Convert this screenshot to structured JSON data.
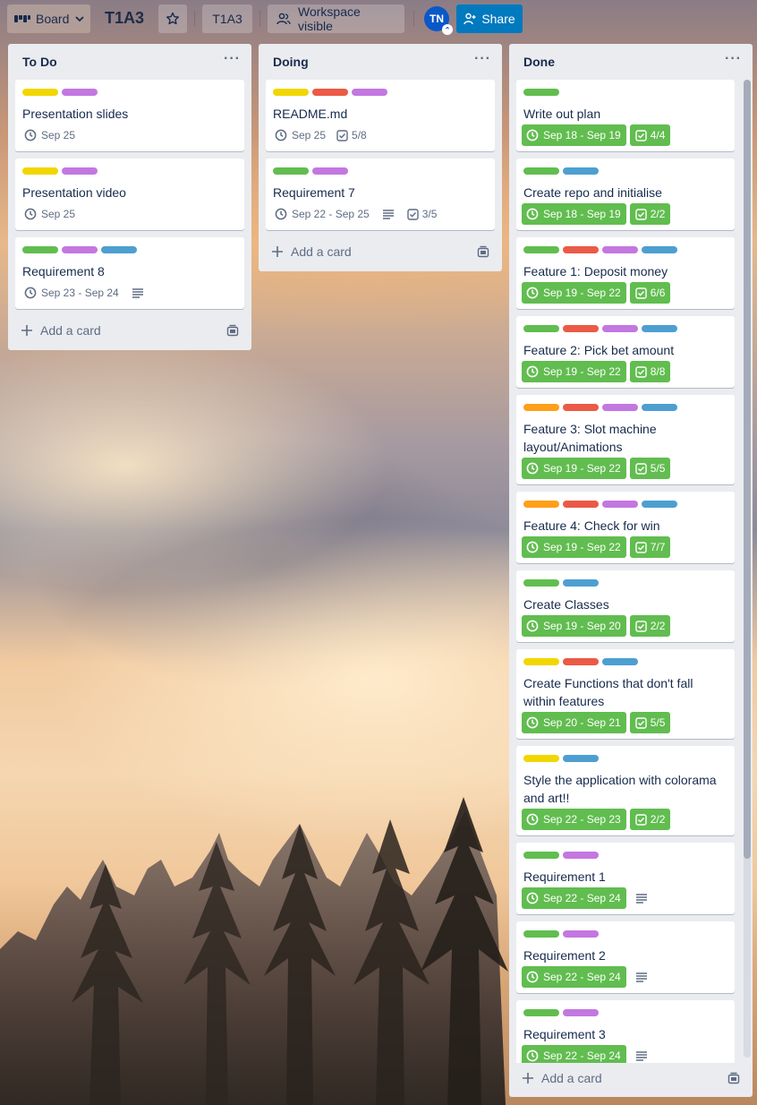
{
  "header": {
    "board_btn": "Board",
    "title": "T1A3",
    "workspace": "T1A3",
    "visibility": "Workspace visible",
    "avatar": "TN",
    "share": "Share"
  },
  "colors": {
    "green": "#61bd4f",
    "yellow": "#f2d600",
    "orange": "#ff9f1a",
    "red": "#eb5a46",
    "purple": "#c377e0",
    "blue": "#0079bf",
    "sky": "#4d9fd1"
  },
  "lists": {
    "todo": {
      "title": "To Do",
      "add_card": "Add a card",
      "cards": [
        {
          "title": "Presentation slides",
          "labels": [
            "yellow",
            "purple"
          ],
          "due": "Sep 25"
        },
        {
          "title": "Presentation video",
          "labels": [
            "yellow",
            "purple"
          ],
          "due": "Sep 25"
        },
        {
          "title": "Requirement 8",
          "labels": [
            "green",
            "purple",
            "sky"
          ],
          "due": "Sep 23 - Sep 24",
          "description": true
        }
      ]
    },
    "doing": {
      "title": "Doing",
      "add_card": "Add a card",
      "cards": [
        {
          "title": "README.md",
          "labels": [
            "yellow",
            "red",
            "purple"
          ],
          "due": "Sep 25",
          "checklist": "5/8"
        },
        {
          "title": "Requirement 7",
          "labels": [
            "green",
            "purple"
          ],
          "due": "Sep 22 - Sep 25",
          "description": true,
          "checklist": "3/5"
        }
      ]
    },
    "done": {
      "title": "Done",
      "add_card": "Add a card",
      "cards": [
        {
          "title": "Write out plan",
          "labels": [
            "green"
          ],
          "due": "Sep 18 - Sep 19",
          "checklist": "4/4"
        },
        {
          "title": "Create repo and initialise",
          "labels": [
            "green",
            "sky"
          ],
          "due": "Sep 18 - Sep 19",
          "checklist": "2/2"
        },
        {
          "title": "Feature 1: Deposit money",
          "labels": [
            "green",
            "red",
            "purple",
            "sky"
          ],
          "due": "Sep 19 - Sep 22",
          "checklist": "6/6"
        },
        {
          "title": "Feature 2: Pick bet amount",
          "labels": [
            "green",
            "red",
            "purple",
            "sky"
          ],
          "due": "Sep 19 - Sep 22",
          "checklist": "8/8"
        },
        {
          "title": "Feature 3: Slot machine layout/Animations",
          "labels": [
            "orange",
            "red",
            "purple",
            "sky"
          ],
          "due": "Sep 19 - Sep 22",
          "checklist": "5/5"
        },
        {
          "title": "Feature 4: Check for win",
          "labels": [
            "orange",
            "red",
            "purple",
            "sky"
          ],
          "due": "Sep 19 - Sep 22",
          "checklist": "7/7"
        },
        {
          "title": "Create Classes",
          "labels": [
            "green",
            "sky"
          ],
          "due": "Sep 19 - Sep 20",
          "checklist": "2/2"
        },
        {
          "title": "Create Functions that don't fall within features",
          "labels": [
            "yellow",
            "red",
            "sky"
          ],
          "due": "Sep 20 - Sep 21",
          "checklist": "5/5"
        },
        {
          "title": "Style the application with colorama and art!!",
          "labels": [
            "yellow",
            "sky"
          ],
          "due": "Sep 22 - Sep 23",
          "checklist": "2/2"
        },
        {
          "title": "Requirement 1",
          "labels": [
            "green",
            "purple"
          ],
          "due": "Sep 22 - Sep 24",
          "description": true
        },
        {
          "title": "Requirement 2",
          "labels": [
            "green",
            "purple"
          ],
          "due": "Sep 22 - Sep 24",
          "description": true
        },
        {
          "title": "Requirement 3",
          "labels": [
            "green",
            "purple"
          ],
          "due": "Sep 22 - Sep 24",
          "description": true
        }
      ]
    }
  }
}
